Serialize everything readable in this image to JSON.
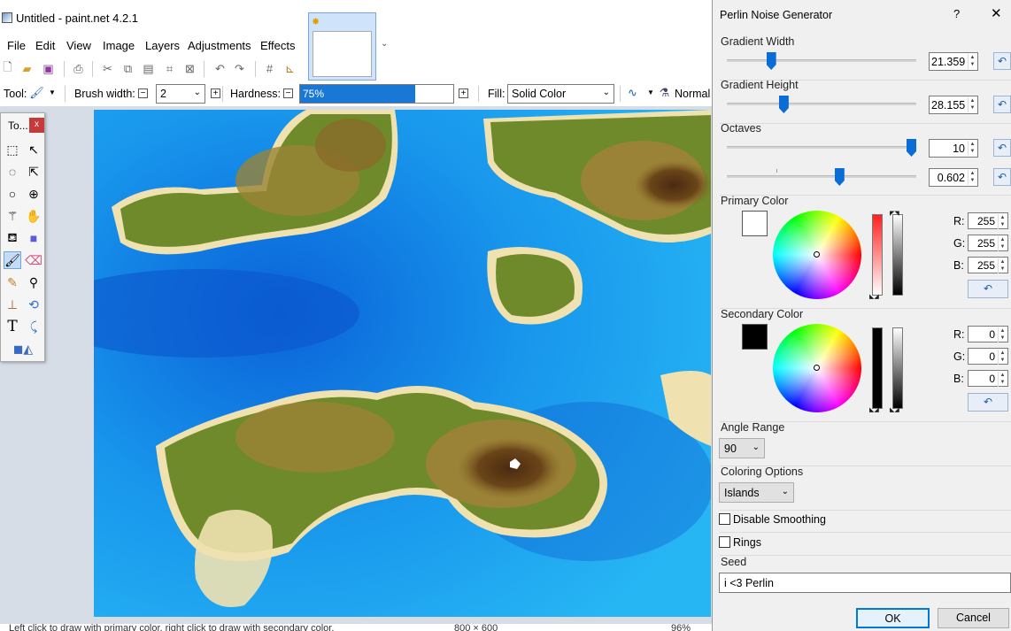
{
  "window": {
    "title": "Untitled - paint.net 4.2.1",
    "menu": [
      "File",
      "Edit",
      "View",
      "Image",
      "Layers",
      "Adjustments",
      "Effects"
    ]
  },
  "toolbar": {
    "tool_label": "Tool:",
    "brush_width_label": "Brush width:",
    "brush_width_value": "2",
    "hardness_label": "Hardness:",
    "hardness_value": "75%",
    "hardness_fraction": 0.75,
    "fill_label": "Fill:",
    "fill_value": "Solid Color",
    "blend_value": "Normal"
  },
  "tools_window": {
    "title": "To...",
    "close": "x",
    "selected_tool": "paintbrush",
    "tools": [
      "rectangle-select",
      "move-selected",
      "lasso-select",
      "move-selection",
      "ellipse-select",
      "zoom",
      "magic-wand",
      "pan",
      "paint-bucket",
      "gradient",
      "paintbrush",
      "eraser",
      "pencil",
      "color-picker",
      "clone-stamp",
      "recolor",
      "text",
      "line-curve",
      "shapes"
    ]
  },
  "status": {
    "hint": "Left click to draw with primary color, right click to draw with secondary color.",
    "size": "800 × 600",
    "zoom": "96%"
  },
  "dialog": {
    "title": "Perlin Noise Generator",
    "help": "?",
    "close": "✕",
    "gradient_width": {
      "label": "Gradient Width",
      "value": "21.359",
      "fraction": 0.22
    },
    "gradient_height": {
      "label": "Gradient Height",
      "value": "28.155",
      "fraction": 0.29
    },
    "octaves": {
      "label": "Octaves",
      "value": "10",
      "fraction": 1.0
    },
    "persistence": {
      "value": "0.602",
      "fraction": 0.6
    },
    "primary_color": {
      "label": "Primary Color",
      "swatch": "#ffffff",
      "r": "255",
      "g": "255",
      "b": "255"
    },
    "secondary_color": {
      "label": "Secondary Color",
      "swatch": "#000000",
      "r": "0",
      "g": "0",
      "b": "0"
    },
    "rgb_labels": {
      "r": "R:",
      "g": "G:",
      "b": "B:"
    },
    "angle_range": {
      "label": "Angle Range",
      "value": "90"
    },
    "coloring_options": {
      "label": "Coloring Options",
      "value": "Islands"
    },
    "disable_smoothing": {
      "label": "Disable Smoothing",
      "checked": false
    },
    "rings": {
      "label": "Rings",
      "checked": false
    },
    "seed": {
      "label": "Seed",
      "value": "i <3 Perlin"
    },
    "ok": "OK",
    "cancel": "Cancel"
  }
}
